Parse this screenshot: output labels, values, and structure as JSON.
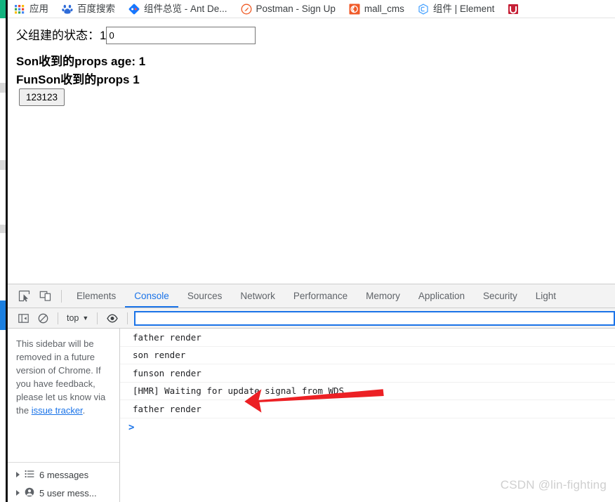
{
  "browser": {
    "bookmarks": [
      {
        "label": "应用",
        "icon": "apps-grid-icon"
      },
      {
        "label": "百度搜索",
        "icon": "baidu-icon"
      },
      {
        "label": "组件总览 - Ant De...",
        "icon": "ant-design-icon"
      },
      {
        "label": "Postman - Sign Up",
        "icon": "postman-icon"
      },
      {
        "label": "mall_cms",
        "icon": "mall-cms-icon"
      },
      {
        "label": "组件 | Element",
        "icon": "element-ui-icon"
      },
      {
        "label": "",
        "icon": "red-bookmark-icon"
      }
    ]
  },
  "page": {
    "state_label": "父组建的状态：1",
    "state_input_value": "0",
    "son_props_line": "Son收到的props age: 1",
    "funson_props_line": "FunSon收到的props 1",
    "button_label": "123123"
  },
  "devtools": {
    "tools": [
      {
        "name": "inspect-element-icon"
      },
      {
        "name": "device-toolbar-icon"
      }
    ],
    "tabs": [
      {
        "label": "Elements",
        "active": false
      },
      {
        "label": "Console",
        "active": true
      },
      {
        "label": "Sources",
        "active": false
      },
      {
        "label": "Network",
        "active": false
      },
      {
        "label": "Performance",
        "active": false
      },
      {
        "label": "Memory",
        "active": false
      },
      {
        "label": "Application",
        "active": false
      },
      {
        "label": "Security",
        "active": false
      },
      {
        "label": "Light",
        "active": false
      }
    ],
    "toolbar": {
      "sidebar_toggle_icon": "show-console-sidebar-icon",
      "clear_icon": "clear-console-icon",
      "context_value": "top",
      "context_caret": "▼",
      "eye_icon": "live-expression-icon",
      "filter_placeholder": "",
      "filter_value": ""
    },
    "sidebar": {
      "note_prefix": "This sidebar will be removed in a future version of Chrome. If you have feedback, please let us know via the ",
      "note_link": "issue tracker",
      "note_suffix": ".",
      "tree": [
        {
          "label": "6 messages",
          "icon": "message-list-icon"
        },
        {
          "label": "5 user mess...",
          "icon": "user-message-icon"
        }
      ]
    },
    "console": {
      "messages": [
        {
          "text": "father render"
        },
        {
          "text": "son render"
        },
        {
          "text": "funson render"
        },
        {
          "text": "[HMR] Waiting for update signal from WDS..."
        },
        {
          "text": "father render"
        }
      ],
      "prompt": ">"
    }
  },
  "annotation": {
    "arrow_color": "#ec2024",
    "arrow_name": "red-pointer-arrow"
  },
  "watermark": "CSDN @lin-fighting",
  "colors": {
    "accent_blue": "#1a73e8",
    "toolbar_bg": "#f3f3f3",
    "border": "#cdcdcd",
    "text": "#3c4043",
    "red": "#ec2024"
  }
}
